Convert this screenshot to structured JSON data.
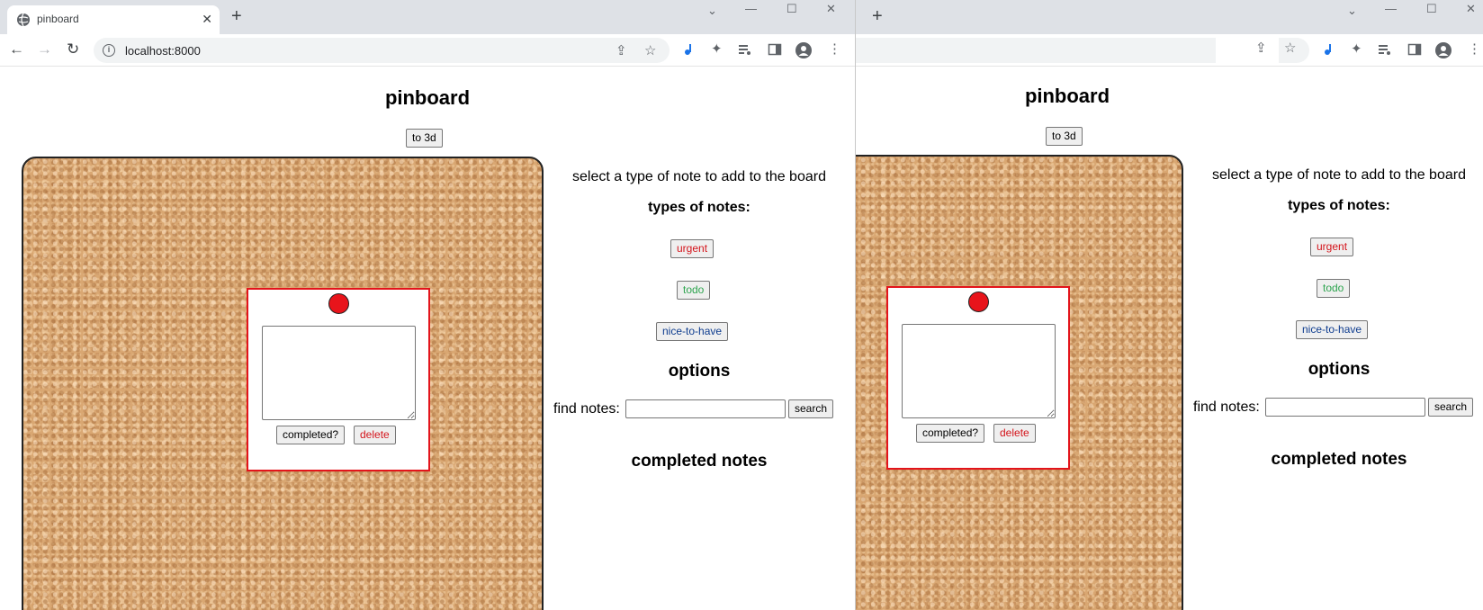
{
  "browser": {
    "tab_title": "pinboard",
    "tab_close": "✕",
    "new_tab": "+",
    "url": "localhost:8000",
    "info_glyph": "i",
    "back": "←",
    "forward": "→",
    "reload": "↻",
    "minimize": "—",
    "maximize": "☐",
    "close": "✕",
    "chevron": "⌄",
    "share": "⇪",
    "star": "☆",
    "extensions": "✦",
    "menu": "⋮"
  },
  "page": {
    "title": "pinboard",
    "to3d_label": "to 3d"
  },
  "note": {
    "completed_label": "completed?",
    "delete_label": "delete"
  },
  "sidebar": {
    "instruction": "select a type of note to add to the board",
    "types_heading": "types of notes:",
    "urgent_label": "urgent",
    "todo_label": "todo",
    "nice_label": "nice-to-have",
    "options_heading": "options",
    "find_label": "find notes:",
    "search_label": "search",
    "completed_heading": "completed notes"
  },
  "colors": {
    "urgent": "#d4141b",
    "todo": "#2ea44f",
    "nice_to_have": "#0f3d8f",
    "pin": "#e8141b",
    "cork": "#d9a772"
  }
}
